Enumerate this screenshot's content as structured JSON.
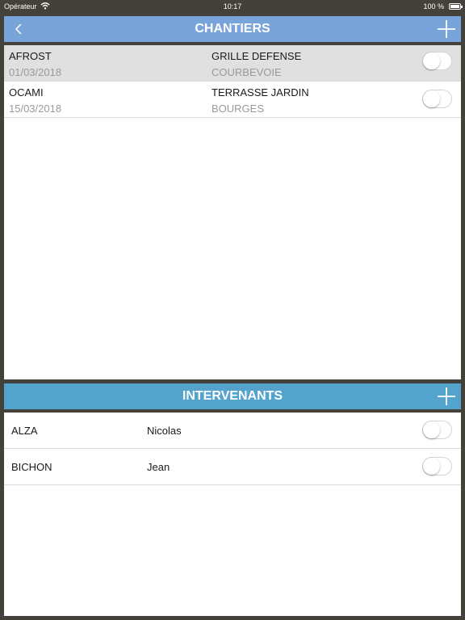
{
  "status_bar": {
    "carrier": "Opérateur",
    "time": "10:17",
    "battery": "100 %"
  },
  "chantiers": {
    "title": "CHANTIERS",
    "rows": [
      {
        "name": "AFROST",
        "date": "01/03/2018",
        "project": "GRILLE DEFENSE",
        "city": "COURBEVOIE",
        "enabled": false,
        "selected": true
      },
      {
        "name": "OCAMI",
        "date": "15/03/2018",
        "project": "TERRASSE JARDIN",
        "city": "BOURGES",
        "enabled": false,
        "selected": false
      }
    ]
  },
  "intervenants": {
    "title": "INTERVENANTS",
    "rows": [
      {
        "last_name": "ALZA",
        "first_name": "Nicolas",
        "enabled": false
      },
      {
        "last_name": "BICHON",
        "first_name": "Jean",
        "enabled": false
      }
    ]
  },
  "icons": {
    "back": "chevron-left-icon",
    "add": "plus-icon",
    "wifi": "wifi-icon",
    "battery": "battery-icon"
  },
  "colors": {
    "background": "#44413a",
    "chantiers_header": "#79a4da",
    "intervenants_header": "#54a3cc",
    "selected_row": "#e0e0e0",
    "secondary_text": "#9a9a9a"
  }
}
